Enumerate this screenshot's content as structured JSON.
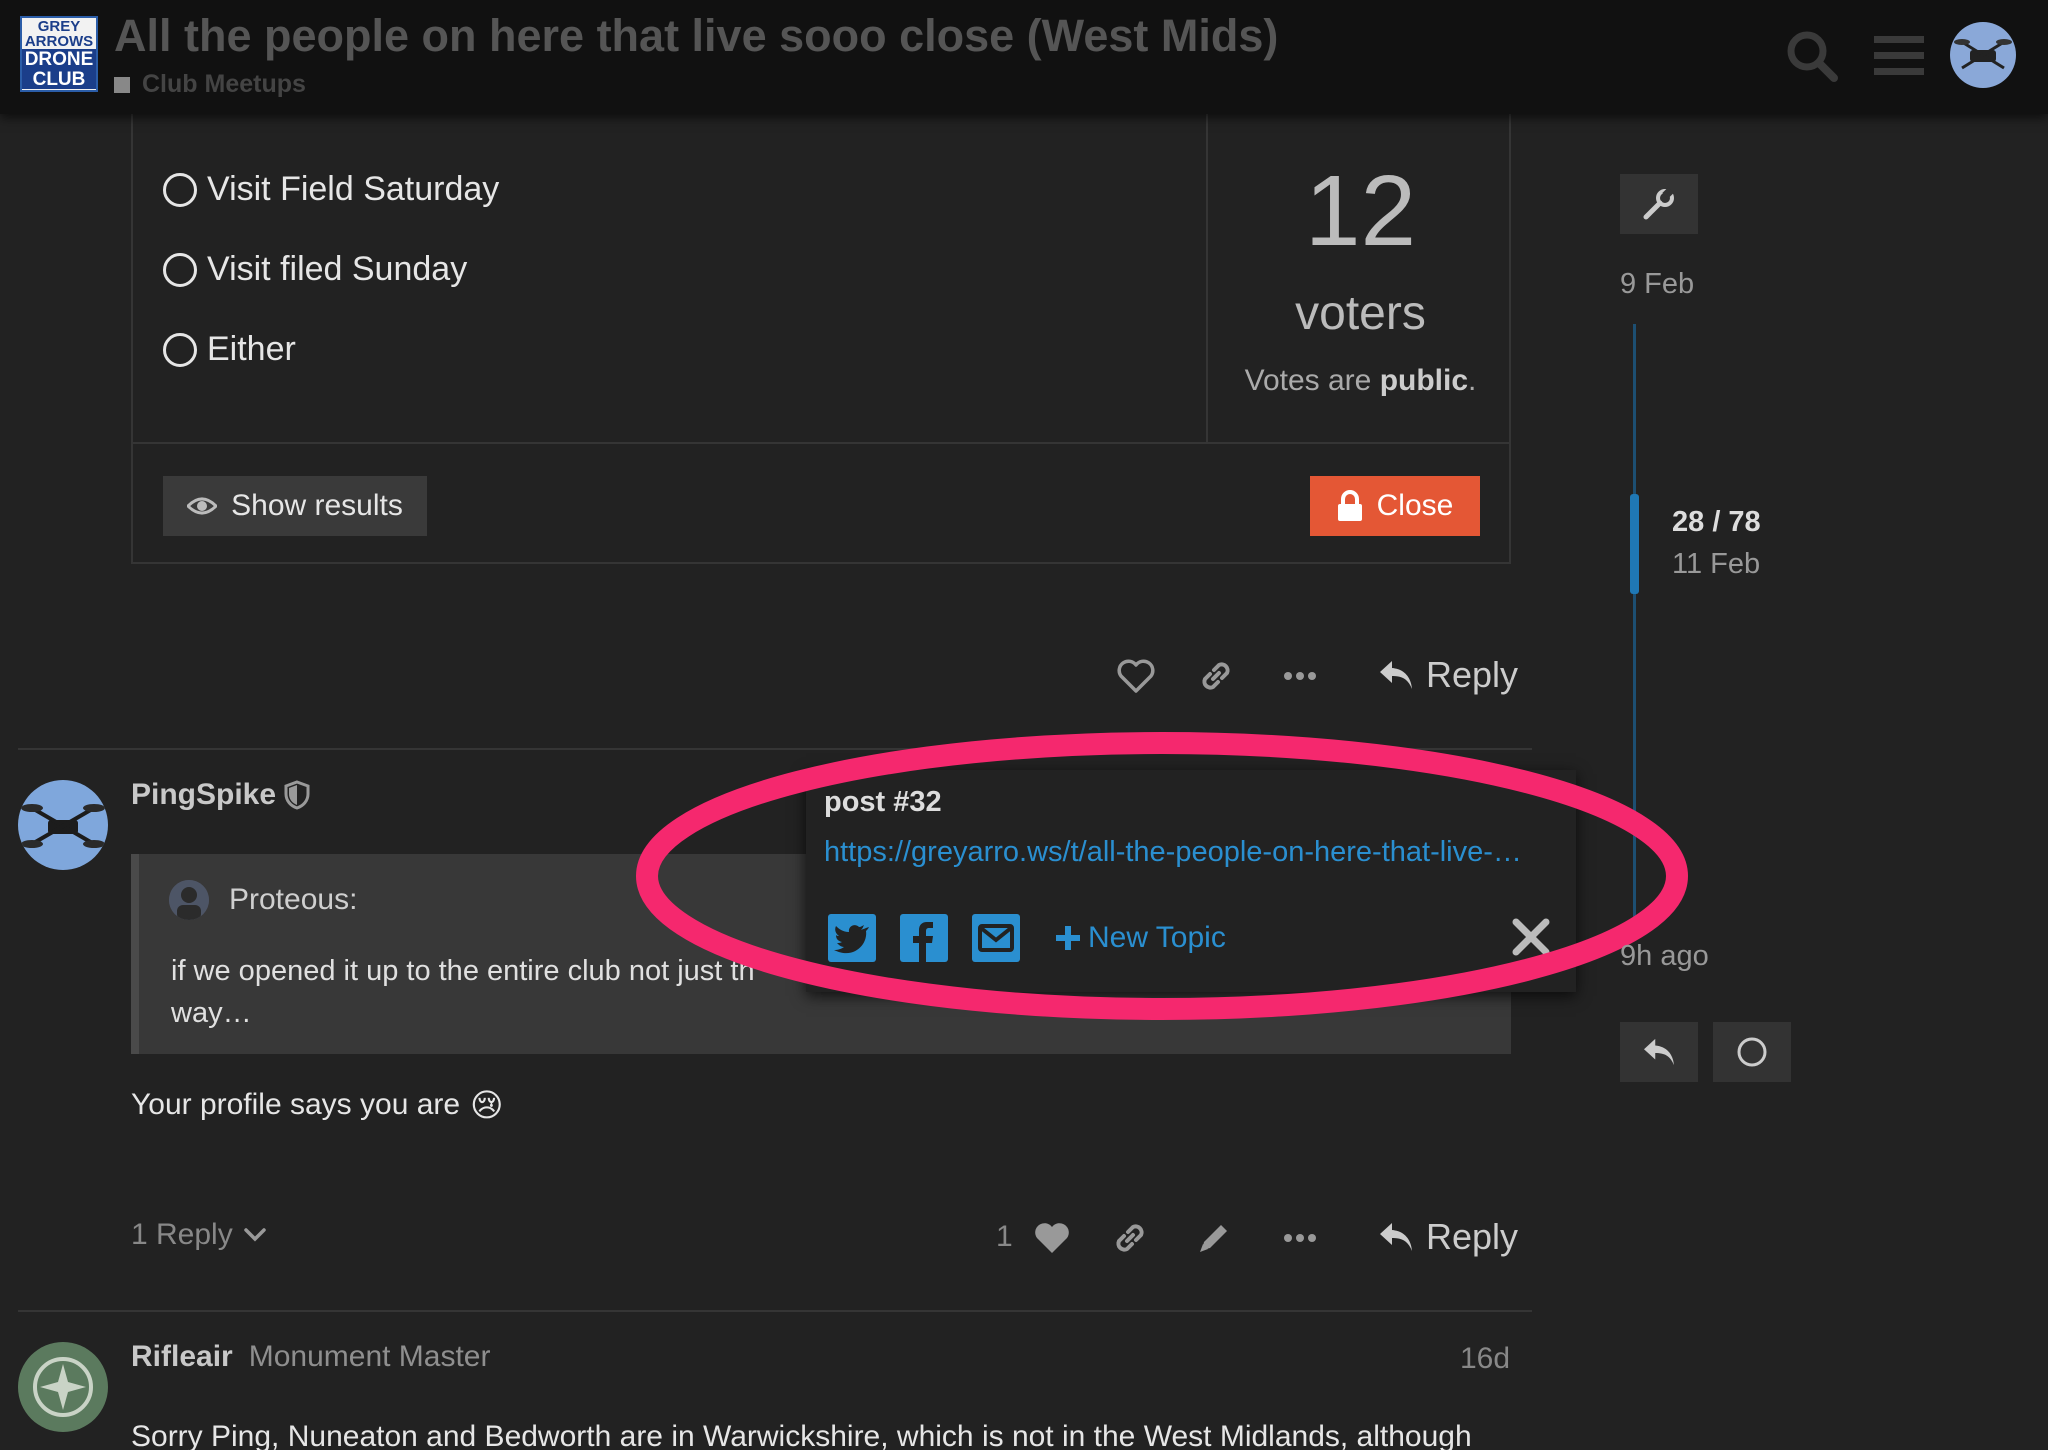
{
  "header": {
    "logo": {
      "line1": "GREY",
      "line2": "ARROWS",
      "line3": "DRONE",
      "line4": "CLUB"
    },
    "title": "All the people on here that live sooo close (West Mids)",
    "category": "Club Meetups"
  },
  "poll": {
    "options": [
      "Visit Field Saturday",
      "Visit filed Sunday",
      "Either"
    ],
    "voter_count": "12",
    "voters_label": "voters",
    "votes_prefix": "Votes are",
    "votes_public": "public",
    "votes_suffix": ".",
    "show_results": "Show results",
    "close": "Close"
  },
  "post_actions": {
    "reply": "Reply"
  },
  "post_ping": {
    "username": "PingSpike",
    "quote_author": "Proteous:",
    "quote_text": "if we opened it up to the entire club not just th",
    "quote_text_2": "way…",
    "body": "Your profile says you are",
    "emoji": "😢",
    "replies": "1 Reply",
    "likes": "1"
  },
  "share": {
    "title": "post #32",
    "url": "https://greyarro.ws/t/all-the-people-on-here-that-live-…",
    "new_topic": "New Topic"
  },
  "timeline": {
    "top_date": "9 Feb",
    "position": "28 / 78",
    "position_date": "11 Feb",
    "bottom_label": "9h ago"
  },
  "post_rifle": {
    "username": "Rifleair",
    "user_title": "Monument Master",
    "age": "16d",
    "body": "Sorry Ping, Nuneaton and Bedworth are in Warwickshire, which is not in the West Midlands, although"
  },
  "colors": {
    "accent": "#2a8fd0",
    "danger": "#e45735",
    "highlight": "#f5286e",
    "background": "#222222",
    "header": "#111111"
  },
  "icons": [
    "search-icon",
    "hamburger-icon",
    "eye-icon",
    "lock-icon",
    "heart-icon",
    "link-icon",
    "ellipsis-icon",
    "reply-icon",
    "pencil-icon",
    "shield-icon",
    "chevron-down-icon",
    "twitter-icon",
    "facebook-icon",
    "email-icon",
    "plus-icon",
    "close-icon",
    "wrench-icon",
    "circle-icon"
  ]
}
